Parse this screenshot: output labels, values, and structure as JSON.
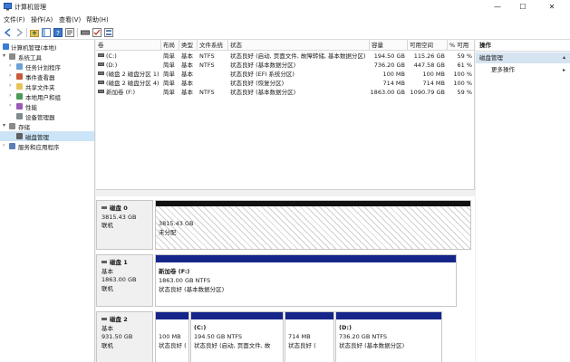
{
  "window": {
    "title": "计算机管理",
    "minimize_glyph": "—",
    "maximize_glyph": "☐",
    "close_glyph": "✕"
  },
  "menu": [
    {
      "label": "文件(F)"
    },
    {
      "label": "操作(A)"
    },
    {
      "label": "查看(V)"
    },
    {
      "label": "帮助(H)"
    }
  ],
  "toolbar": {
    "icons": [
      "back-icon",
      "forward-icon",
      "up-folder-icon",
      "show-hide-tree-icon",
      "help-icon",
      "properties-icon",
      "disk-settings-icon",
      "check-icon",
      "view-icon"
    ]
  },
  "tree": {
    "items": [
      {
        "label": "计算机管理(本地)",
        "arrow": "",
        "icon": "computer-icon",
        "level": 0
      },
      {
        "label": "系统工具",
        "arrow": "▾",
        "icon": "tools-icon",
        "level": 1
      },
      {
        "label": "任务计划程序",
        "arrow": "›",
        "icon": "task-icon",
        "level": 2
      },
      {
        "label": "事件查看器",
        "arrow": "›",
        "icon": "event-icon",
        "level": 2
      },
      {
        "label": "共享文件夹",
        "arrow": "›",
        "icon": "share-icon",
        "level": 2
      },
      {
        "label": "本地用户和组",
        "arrow": "›",
        "icon": "users-icon",
        "level": 2
      },
      {
        "label": "性能",
        "arrow": "›",
        "icon": "perf-icon",
        "level": 2
      },
      {
        "label": "设备管理器",
        "arrow": "",
        "icon": "device-icon",
        "level": 2
      },
      {
        "label": "存储",
        "arrow": "▾",
        "icon": "storage-icon",
        "level": 1
      },
      {
        "label": "磁盘管理",
        "arrow": "",
        "icon": "disk-mgmt-icon",
        "level": 2,
        "selected": true
      },
      {
        "label": "服务和应用程序",
        "arrow": "›",
        "icon": "services-icon",
        "level": 1
      }
    ]
  },
  "volume_table": {
    "columns": [
      "卷",
      "布局",
      "类型",
      "文件系统",
      "状态",
      "容量",
      "可用空间",
      "% 可用"
    ],
    "rows": [
      {
        "volume": "(C:)",
        "layout": "简单",
        "type": "基本",
        "fs": "NTFS",
        "status": "状态良好 (启动, 页面文件, 故障转储, 基本数据分区)",
        "capacity": "194.50 GB",
        "free": "115.26 GB",
        "pct": "59 %"
      },
      {
        "volume": "(D:)",
        "layout": "简单",
        "type": "基本",
        "fs": "NTFS",
        "status": "状态良好 (基本数据分区)",
        "capacity": "736.20 GB",
        "free": "447.58 GB",
        "pct": "61 %"
      },
      {
        "volume": "(磁盘 2 磁盘分区 1)",
        "layout": "简单",
        "type": "基本",
        "fs": "",
        "status": "状态良好 (EFI 系统分区)",
        "capacity": "100 MB",
        "free": "100 MB",
        "pct": "100 %"
      },
      {
        "volume": "(磁盘 2 磁盘分区 4)",
        "layout": "简单",
        "type": "基本",
        "fs": "",
        "status": "状态良好 (恢复分区)",
        "capacity": "714 MB",
        "free": "714 MB",
        "pct": "100 %"
      },
      {
        "volume": "新加卷 (F:)",
        "layout": "简单",
        "type": "基本",
        "fs": "NTFS",
        "status": "状态良好 (基本数据分区)",
        "capacity": "1863.00 GB",
        "free": "1090.79 GB",
        "pct": "59 %"
      }
    ]
  },
  "actions": {
    "title": "操作",
    "section": "磁盘管理",
    "section_arrow": "▴",
    "more": "更多操作",
    "more_arrow": "▸"
  },
  "disks": [
    {
      "name": "磁盘 0",
      "type": "",
      "size": "3815.43 GB",
      "status": "联机",
      "partitions": [
        {
          "name": "",
          "line1": "3815.43 GB",
          "line2": "未分配",
          "style": "unallocated"
        }
      ]
    },
    {
      "name": "磁盘 1",
      "type": "基本",
      "size": "1863.00 GB",
      "status": "联机",
      "partitions": [
        {
          "name": "新加卷  (F:)",
          "line1": "1863.00 GB NTFS",
          "line2": "状态良好 (基本数据分区)",
          "style": "primary"
        }
      ]
    },
    {
      "name": "磁盘 2",
      "type": "基本",
      "size": "931.50 GB",
      "status": "联机",
      "partitions": [
        {
          "name": "",
          "line1": "100 MB",
          "line2": "状态良好 (",
          "style": "primary"
        },
        {
          "name": "(C:)",
          "line1": "194.50 GB NTFS",
          "line2": "状态良好 (启动, 页面文件, 故",
          "style": "primary"
        },
        {
          "name": "",
          "line1": "714 MB",
          "line2": "状态良好 (",
          "style": "primary"
        },
        {
          "name": "(D:)",
          "line1": "736.20 GB NTFS",
          "line2": "状态良好 (基本数据分区)",
          "style": "primary"
        }
      ]
    }
  ],
  "colors": {
    "unallocated_bar": "#111111",
    "primary_bar": "#16258a",
    "selected_tree": "#cce4f7",
    "action_section": "#d6e4f2"
  }
}
